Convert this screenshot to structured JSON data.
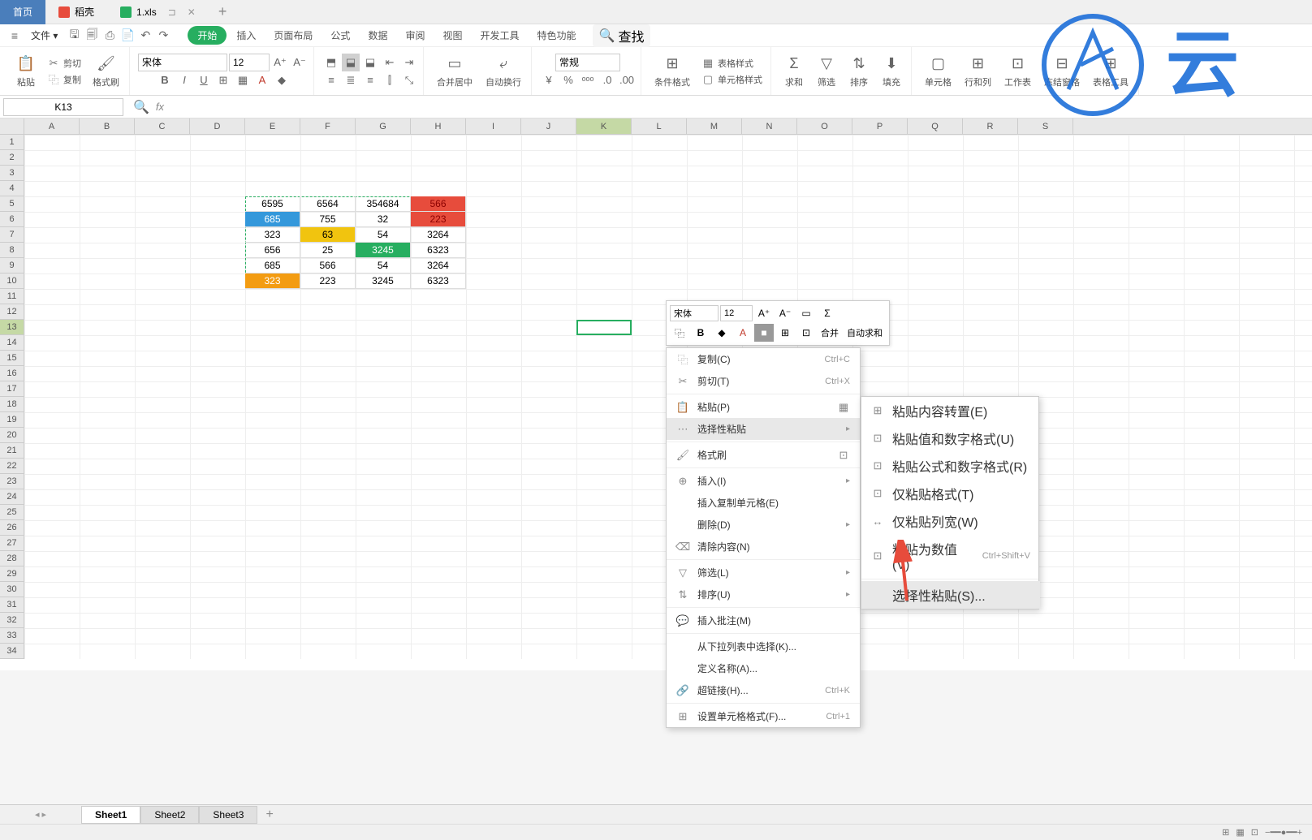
{
  "tabs": {
    "home": "首页",
    "docer": "稻壳",
    "file": "1.xls",
    "add": "+"
  },
  "menu": {
    "file": "文件",
    "tabs": [
      "开始",
      "插入",
      "页面布局",
      "公式",
      "数据",
      "审阅",
      "视图",
      "开发工具",
      "特色功能"
    ],
    "search": "查找"
  },
  "ribbon": {
    "paste": "粘贴",
    "cut": "剪切",
    "copy": "复制",
    "format_painter": "格式刷",
    "font_name": "宋体",
    "font_size": "12",
    "merge": "合并居中",
    "wrap": "自动换行",
    "general": "常规",
    "cond_fmt": "条件格式",
    "table_style": "表格样式",
    "cell_style": "单元格样式",
    "sum": "求和",
    "filter": "筛选",
    "sort": "排序",
    "fill": "填充",
    "cell": "单元格",
    "row_col": "行和列",
    "worksheet": "工作表",
    "freeze": "冻结窗格",
    "table_tools": "表格工具"
  },
  "formula_bar": {
    "cell_ref": "K13",
    "fx": "fx"
  },
  "columns": [
    "A",
    "B",
    "C",
    "D",
    "E",
    "F",
    "G",
    "H",
    "I",
    "J",
    "K",
    "L",
    "M",
    "N",
    "O",
    "P",
    "Q",
    "R",
    "S"
  ],
  "rows": [
    "1",
    "2",
    "3",
    "4",
    "5",
    "6",
    "7",
    "8",
    "9",
    "10",
    "11",
    "12",
    "13",
    "14",
    "15",
    "16",
    "17",
    "18",
    "19",
    "20",
    "21",
    "22",
    "23",
    "24",
    "25",
    "26",
    "27",
    "28",
    "29",
    "30",
    "31",
    "32",
    "33",
    "34"
  ],
  "data": {
    "r5": {
      "E": "6595",
      "F": "6564",
      "G": "354684",
      "H": "566"
    },
    "r6": {
      "E": "685",
      "F": "755",
      "G": "32",
      "H": "223"
    },
    "r7": {
      "E": "323",
      "F": "63",
      "G": "54",
      "H": "3264"
    },
    "r8": {
      "E": "656",
      "F": "25",
      "G": "3245",
      "H": "6323"
    },
    "r9": {
      "E": "685",
      "F": "566",
      "G": "54",
      "H": "3264"
    },
    "r10": {
      "E": "323",
      "F": "223",
      "G": "3245",
      "H": "6323"
    }
  },
  "cell_colors": {
    "H5": "#e74c3c",
    "H6": "#e74c3c",
    "E6": "#3498db",
    "F7": "#f1c40f",
    "G8": "#27ae60",
    "E10": "#f39c12"
  },
  "sheets": [
    "Sheet1",
    "Sheet2",
    "Sheet3"
  ],
  "mini_toolbar": {
    "font": "宋体",
    "size": "12",
    "merge": "合并",
    "autosum": "自动求和"
  },
  "context_menu": {
    "copy": "复制(C)",
    "copy_sc": "Ctrl+C",
    "cut": "剪切(T)",
    "cut_sc": "Ctrl+X",
    "paste": "粘贴(P)",
    "paste_special": "选择性粘贴",
    "fmt_painter": "格式刷",
    "insert": "插入(I)",
    "insert_copied": "插入复制单元格(E)",
    "delete": "删除(D)",
    "clear": "清除内容(N)",
    "filter": "筛选(L)",
    "sort": "排序(U)",
    "comment": "插入批注(M)",
    "dropdown": "从下拉列表中选择(K)...",
    "define_name": "定义名称(A)...",
    "hyperlink": "超链接(H)...",
    "hyperlink_sc": "Ctrl+K",
    "format_cells": "设置单元格格式(F)...",
    "format_cells_sc": "Ctrl+1"
  },
  "paste_submenu": {
    "transpose": "粘贴内容转置(E)",
    "values_fmt": "粘贴值和数字格式(U)",
    "formulas_fmt": "粘贴公式和数字格式(R)",
    "only_fmt": "仅粘贴格式(T)",
    "col_width": "仅粘贴列宽(W)",
    "as_values": "粘贴为数值(V)",
    "as_values_sc": "Ctrl+Shift+V",
    "paste_special": "选择性粘贴(S)..."
  },
  "watermark_text": "云"
}
